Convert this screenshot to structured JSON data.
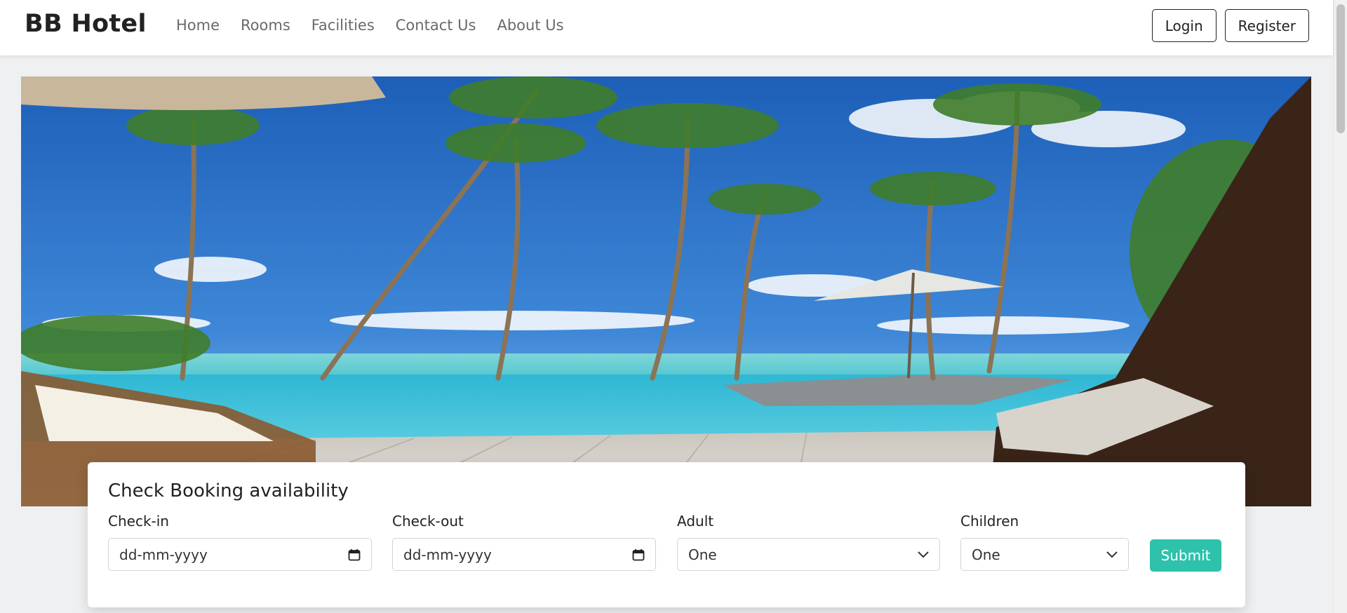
{
  "brand": "BB Hotel",
  "nav": [
    "Home",
    "Rooms",
    "Facilities",
    "Contact Us",
    "About Us"
  ],
  "auth": {
    "login": "Login",
    "register": "Register"
  },
  "booking": {
    "title": "Check Booking availability",
    "checkin": {
      "label": "Check-in",
      "placeholder": "dd-mm-yyyy"
    },
    "checkout": {
      "label": "Check-out",
      "placeholder": "dd-mm-yyyy"
    },
    "adult": {
      "label": "Adult",
      "value": "One"
    },
    "children": {
      "label": "Children",
      "value": "One"
    },
    "submit": "Submit"
  },
  "colors": {
    "accent": "#2ec1ac"
  }
}
